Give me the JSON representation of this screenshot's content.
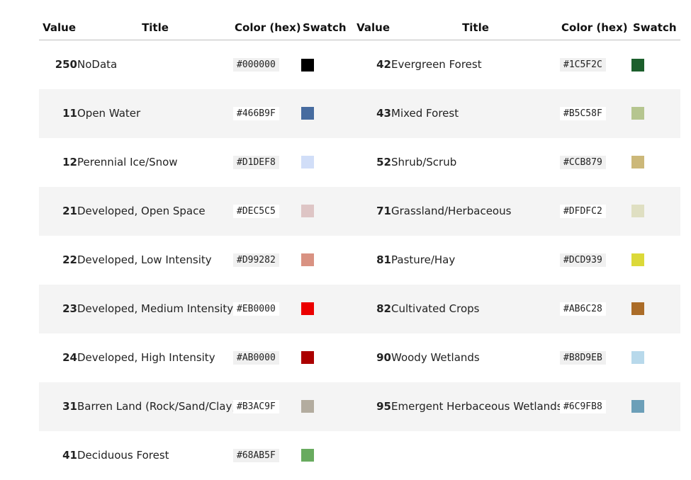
{
  "headers": {
    "value": "Value",
    "title": "Title",
    "hex": "Color (hex)",
    "swatch": "Swatch"
  },
  "rows": [
    {
      "left": {
        "value": "250",
        "title": "NoData",
        "hex": "#000000"
      },
      "right": {
        "value": "42",
        "title": "Evergreen Forest",
        "hex": "#1C5F2C"
      }
    },
    {
      "left": {
        "value": "11",
        "title": "Open Water",
        "hex": "#466B9F"
      },
      "right": {
        "value": "43",
        "title": "Mixed Forest",
        "hex": "#B5C58F"
      }
    },
    {
      "left": {
        "value": "12",
        "title": "Perennial Ice/Snow",
        "hex": "#D1DEF8"
      },
      "right": {
        "value": "52",
        "title": "Shrub/Scrub",
        "hex": "#CCB879"
      }
    },
    {
      "left": {
        "value": "21",
        "title": "Developed, Open Space",
        "hex": "#DEC5C5"
      },
      "right": {
        "value": "71",
        "title": "Grassland/Herbaceous",
        "hex": "#DFDFC2"
      }
    },
    {
      "left": {
        "value": "22",
        "title": "Developed, Low Intensity",
        "hex": "#D99282"
      },
      "right": {
        "value": "81",
        "title": "Pasture/Hay",
        "hex": "#DCD939"
      }
    },
    {
      "left": {
        "value": "23",
        "title": "Developed, Medium Intensity",
        "hex": "#EB0000"
      },
      "right": {
        "value": "82",
        "title": "Cultivated Crops",
        "hex": "#AB6C28"
      }
    },
    {
      "left": {
        "value": "24",
        "title": "Developed, High Intensity",
        "hex": "#AB0000"
      },
      "right": {
        "value": "90",
        "title": "Woody Wetlands",
        "hex": "#B8D9EB"
      }
    },
    {
      "left": {
        "value": "31",
        "title": "Barren Land (Rock/Sand/Clay)",
        "hex": "#B3AC9F"
      },
      "right": {
        "value": "95",
        "title": "Emergent Herbaceous Wetlands",
        "hex": "#6C9FB8"
      }
    },
    {
      "left": {
        "value": "41",
        "title": "Deciduous Forest",
        "hex": "#68AB5F"
      },
      "right": null
    }
  ]
}
